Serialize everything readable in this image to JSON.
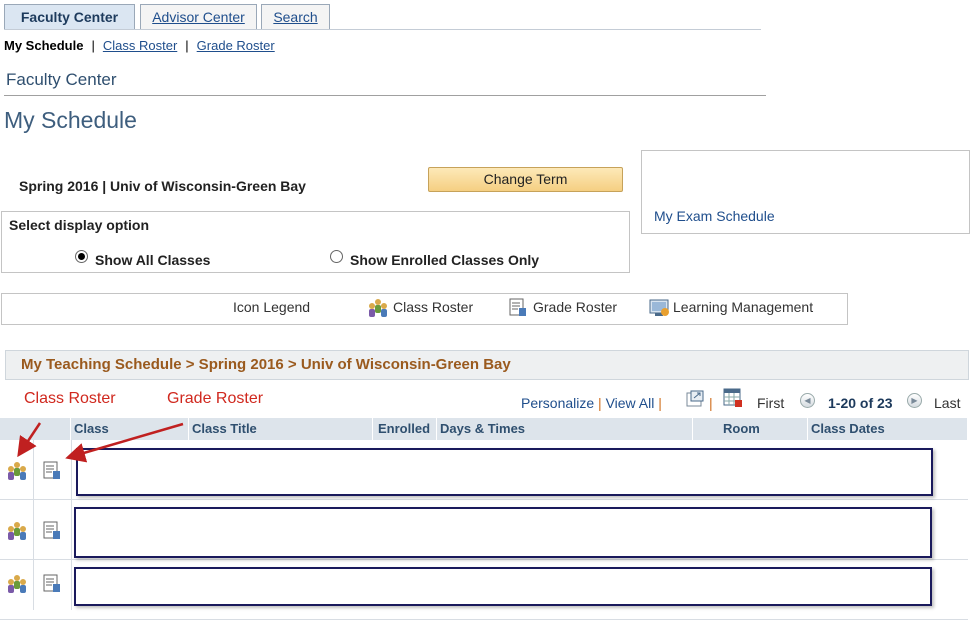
{
  "tabs": [
    {
      "label": "Faculty Center",
      "active": true
    },
    {
      "label": "Advisor Center",
      "active": false
    },
    {
      "label": "Search",
      "active": false
    }
  ],
  "subnav": {
    "current": "My Schedule",
    "links": [
      "Class Roster",
      "Grade Roster"
    ],
    "separator": "|"
  },
  "section_title": "Faculty Center",
  "page_title": "My Schedule",
  "term": {
    "label": "Spring 2016 | Univ of Wisconsin-Green Bay",
    "change_button": "Change Term"
  },
  "exam": {
    "link": "My Exam Schedule"
  },
  "display_option": {
    "title": "Select display option",
    "options": [
      {
        "label": "Show All Classes",
        "selected": true
      },
      {
        "label": "Show Enrolled Classes Only",
        "selected": false
      }
    ]
  },
  "legend": {
    "title": "Icon Legend",
    "items": [
      {
        "icon": "class-roster-icon",
        "label": "Class Roster"
      },
      {
        "icon": "grade-roster-icon",
        "label": "Grade Roster"
      },
      {
        "icon": "learning-management-icon",
        "label": "Learning Management"
      }
    ]
  },
  "schedule": {
    "title": "My Teaching Schedule > Spring 2016 > Univ of Wisconsin-Green Bay",
    "annotations": {
      "class_roster": "Class Roster",
      "grade_roster": "Grade Roster"
    },
    "nav": {
      "personalize": "Personalize",
      "view_all": "View All",
      "first": "First",
      "range": "1-20 of 23",
      "last": "Last",
      "separator": "|"
    },
    "columns": [
      "Class",
      "Class Title",
      "Enrolled",
      "Days & Times",
      "Room",
      "Class Dates"
    ]
  },
  "colors": {
    "accent": "#1f4e8c",
    "schedule_title": "#9a5a1e",
    "annotation": "#d0281e",
    "redaction_border": "#1a1a5c"
  }
}
